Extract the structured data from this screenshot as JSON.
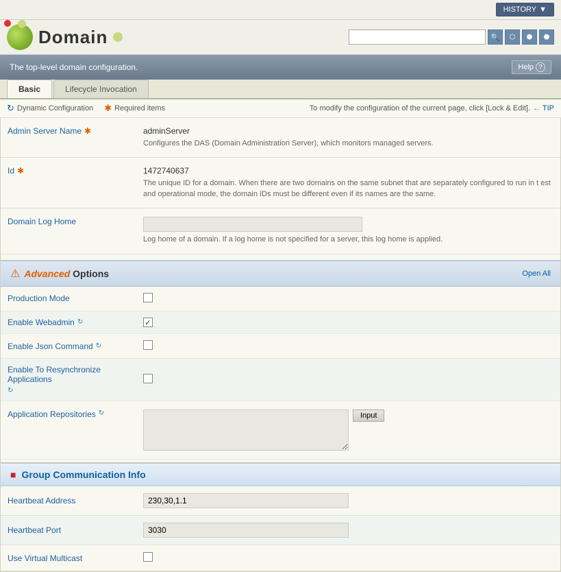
{
  "header": {
    "title": "Domain",
    "history_label": "HISTORY",
    "help_label": "Help",
    "help_icon": "?",
    "search_placeholder": ""
  },
  "info_bar": {
    "description": "The top-level domain configuration.",
    "help_label": "Help",
    "help_icon": "?"
  },
  "tabs": [
    {
      "id": "basic",
      "label": "Basic",
      "active": true
    },
    {
      "id": "lifecycle",
      "label": "Lifecycle Invocation",
      "active": false
    }
  ],
  "config_bar": {
    "dynamic_label": "Dynamic Configuration",
    "required_label": "Required items",
    "tip_text": "To modify the configuration of the current page, click [Lock & Edit].",
    "tip_link": "TIP"
  },
  "fields": [
    {
      "id": "admin-server-name",
      "label": "Admin Server Name",
      "required": true,
      "value": "adminServer",
      "description": "Configures the DAS (Domain Administration Server), which monitors managed servers."
    },
    {
      "id": "id",
      "label": "Id",
      "required": true,
      "value": "1472740637",
      "description": "The unique ID for a domain. When there are two domains on the same subnet that are separately configured to run in t est and operational mode, the domain IDs must be different even if its names are the same."
    },
    {
      "id": "domain-log-home",
      "label": "Domain Log Home",
      "required": false,
      "value": "",
      "description": "Log home of a domain. If a log home is not specified for a server, this log home is applied."
    }
  ],
  "advanced": {
    "title_italic": "Advanced",
    "title_rest": "Options",
    "open_all": "Open All",
    "rows": [
      {
        "id": "production-mode",
        "label": "Production Mode",
        "type": "checkbox",
        "checked": false,
        "has_sync": false
      },
      {
        "id": "enable-webadmin",
        "label": "Enable Webadmin",
        "type": "checkbox",
        "checked": true,
        "has_sync": true
      },
      {
        "id": "enable-json-command",
        "label": "Enable Json Command",
        "type": "checkbox",
        "checked": false,
        "has_sync": true
      },
      {
        "id": "enable-resync-apps",
        "label": "Enable To Resynchronize Applications",
        "type": "checkbox",
        "checked": false,
        "has_sync": true
      },
      {
        "id": "app-repositories",
        "label": "Application Repositories",
        "type": "textarea",
        "value": "",
        "has_sync": true,
        "input_btn": "Input"
      }
    ]
  },
  "group_comm": {
    "title": "Group Communication Info",
    "rows": [
      {
        "id": "heartbeat-address",
        "label": "Heartbeat Address",
        "value": "230,30,1.1"
      },
      {
        "id": "heartbeat-port",
        "label": "Heartbeat Port",
        "value": "3030"
      },
      {
        "id": "use-virtual-multicast",
        "label": "Use Virtual Multicast",
        "type": "checkbox",
        "checked": false
      }
    ]
  },
  "icons": {
    "search": "🔍",
    "history_arrow": "▼",
    "sync": "↻",
    "warning": "⚠",
    "group": "■"
  }
}
